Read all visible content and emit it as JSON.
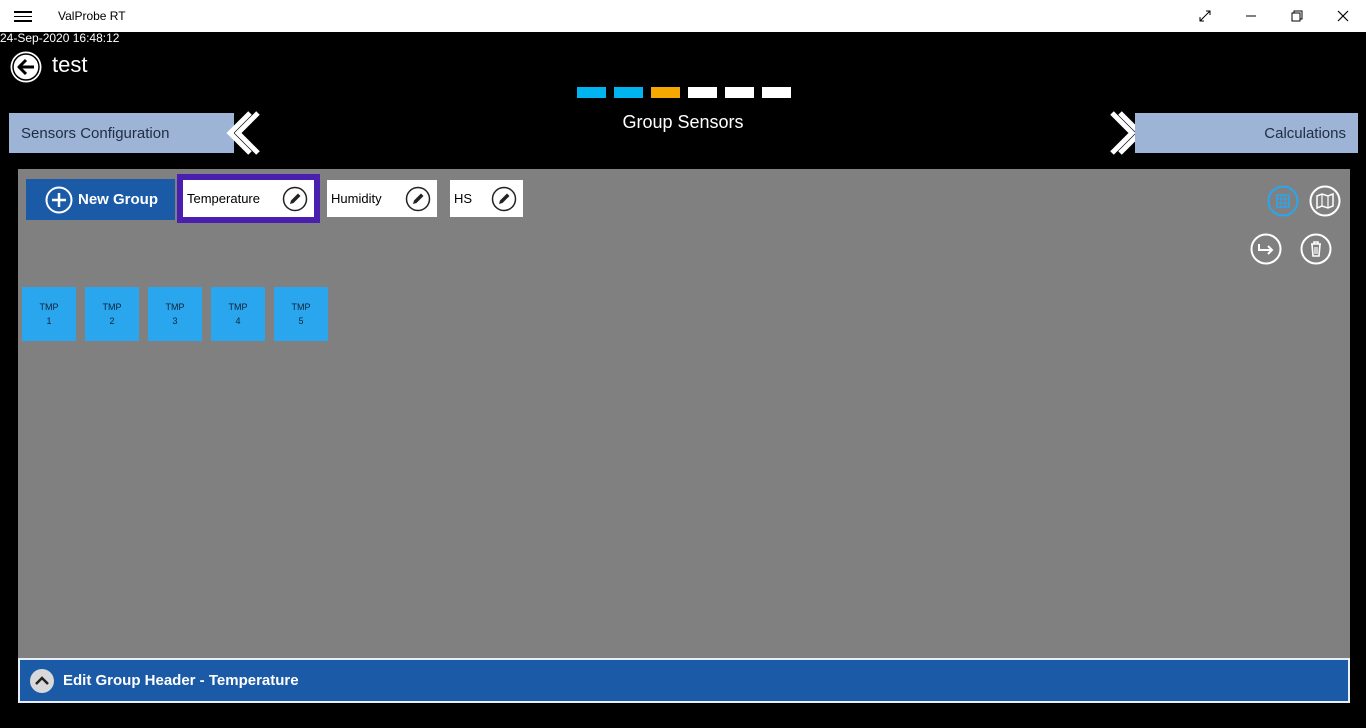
{
  "titlebar": {
    "app_title": "ValProbe RT"
  },
  "header": {
    "datetime": "24-Sep-2020 16:48:12",
    "title": "test"
  },
  "steps": {
    "colors": [
      "#00b4f0",
      "#00b4f0",
      "#f5a800",
      "#ffffff",
      "#ffffff",
      "#ffffff"
    ]
  },
  "navigation": {
    "prev_label": "Sensors Configuration",
    "current_label": "Group Sensors",
    "next_label": "Calculations"
  },
  "toolbar": {
    "new_group_label": "New Group"
  },
  "group_tabs": [
    {
      "label": "Temperature",
      "selected": true
    },
    {
      "label": "Humidity",
      "selected": false
    },
    {
      "label": "HS",
      "selected": false
    }
  ],
  "sensors": [
    {
      "type": "TMP",
      "number": "1"
    },
    {
      "type": "TMP",
      "number": "2"
    },
    {
      "type": "TMP",
      "number": "3"
    },
    {
      "type": "TMP",
      "number": "4"
    },
    {
      "type": "TMP",
      "number": "5"
    }
  ],
  "footer": {
    "label": "Edit Group Header - Temperature"
  },
  "colors": {
    "accent": "#1b5aa6",
    "tile": "#2aa6ee",
    "selected_outline": "#4a1fb0",
    "panel": "#808080"
  }
}
